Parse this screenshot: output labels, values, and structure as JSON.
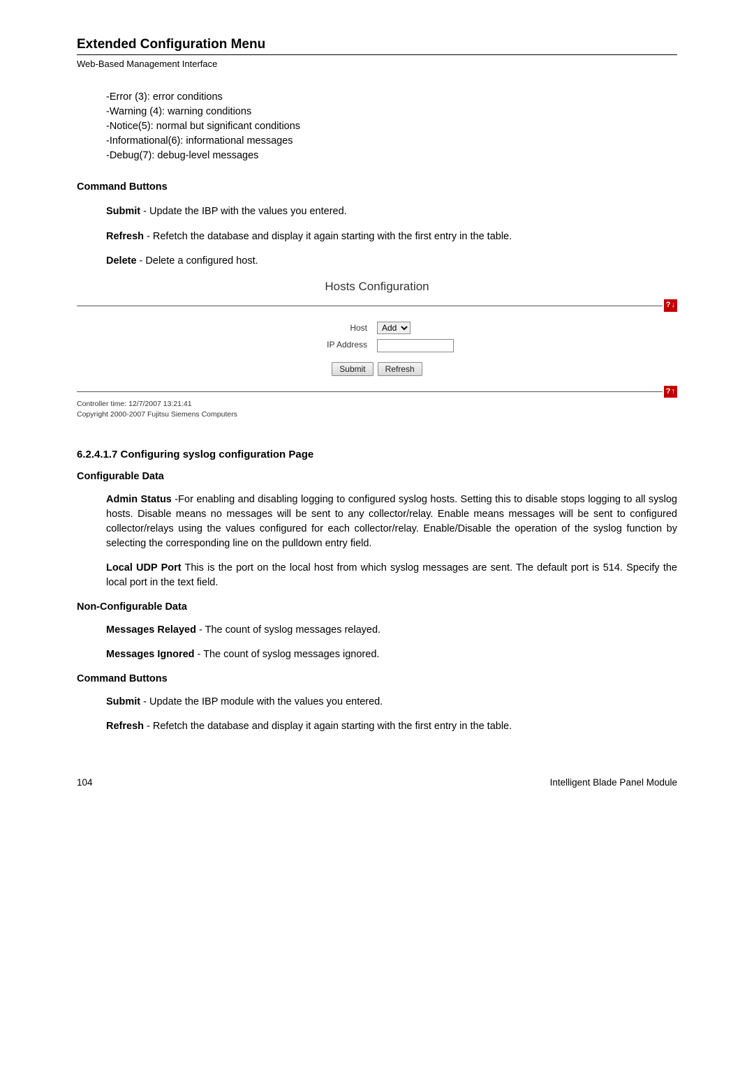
{
  "header": {
    "title": "Extended Configuration Menu",
    "subtitle": "Web-Based Management Interface"
  },
  "severity_list": [
    "-Error (3): error conditions",
    "-Warning (4): warning conditions",
    "-Notice(5): normal but significant conditions",
    "-Informational(6): informational messages",
    "-Debug(7): debug-level messages"
  ],
  "cmd_buttons_label": "Command Buttons",
  "cmd1": {
    "submit_b": "Submit",
    "submit_t": " - Update the IBP with the values you entered.",
    "refresh_b": "Refresh",
    "refresh_t": " - Refetch the database and display it again starting with the first entry in the table.",
    "delete_b": "Delete",
    "delete_t": " - Delete a configured host."
  },
  "panel": {
    "title": "Hosts Configuration",
    "host_label": "Host",
    "host_option": "Add",
    "ip_label": "IP Address",
    "submit_btn": "Submit",
    "refresh_btn": "Refresh",
    "help_symbol": "?",
    "arrow_down": "↓",
    "arrow_up": "↑",
    "footer_time": "Controller time: 12/7/2007 13:21:41",
    "footer_copy": "Copyright 2000-2007 Fujitsu Siemens Computers"
  },
  "section2": {
    "num_heading": "6.2.4.1.7   Configuring syslog configuration Page",
    "configurable_label": "Configurable Data",
    "admin_b": "Admin Status",
    "admin_t": " -For enabling and disabling logging to configured syslog hosts. Setting this to disable stops logging to all syslog hosts. Disable means no messages will be sent to any collector/relay. Enable means messages will be sent to configured collector/relays using the values configured for each collector/relay. Enable/Disable the operation of the syslog function by selecting the corresponding line on the pulldown entry field.",
    "local_b": "Local UDP Port",
    "local_t": " This is the port on the local host from which syslog messages are sent. The default port is 514. Specify the local port in the text field.",
    "noncfg_label": "Non-Configurable Data",
    "relayed_b": "Messages Relayed",
    "relayed_t": " - The count of syslog messages relayed.",
    "ignored_b": "Messages Ignored",
    "ignored_t": " - The count of syslog messages ignored.",
    "cmd_label": "Command Buttons",
    "submit_b": "Submit",
    "submit_t": " - Update the IBP module with the values you entered.",
    "refresh_b": "Refresh",
    "refresh_t": " - Refetch the database and display it again starting with the first entry in the table."
  },
  "footer": {
    "page": "104",
    "right": "Intelligent Blade Panel Module"
  }
}
